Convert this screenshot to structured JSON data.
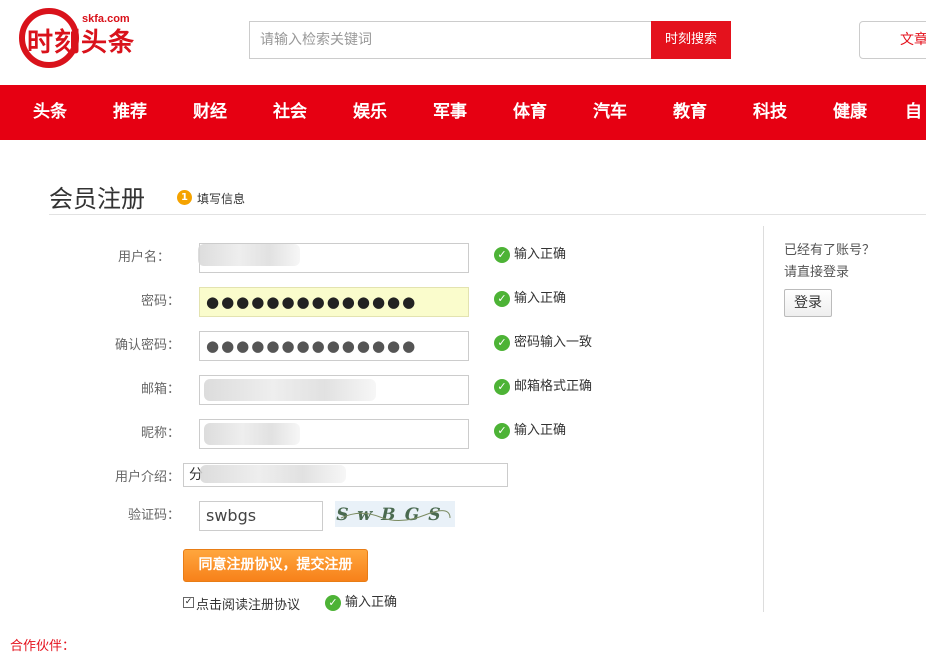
{
  "header": {
    "logo_text": "时刻头条",
    "logo_domain": "skfa.com",
    "search_placeholder": "请输入检索关键词",
    "search_button": "时刻搜索",
    "article_button": "文章"
  },
  "nav": {
    "items": [
      "头条",
      "推荐",
      "财经",
      "社会",
      "娱乐",
      "军事",
      "体育",
      "汽车",
      "教育",
      "科技",
      "健康",
      "自媒"
    ]
  },
  "page": {
    "title": "会员注册",
    "step_number": "1",
    "step_label": "填写信息"
  },
  "form": {
    "username_label": "用户名：",
    "password_label": "密码：",
    "password_mask": "●●●●●●●●●●●●●●",
    "confirm_label": "确认密码：",
    "confirm_mask": "●●●●●●●●●●●●●●",
    "email_label": "邮箱：",
    "nickname_label": "昵称：",
    "intro_label": "用户介绍：",
    "intro_value_start": "分",
    "captcha_label": "验证码：",
    "captcha_value": "swbgs",
    "captcha_image_text": "SwBGS",
    "submit_button": "同意注册协议，提交注册",
    "agree_label": "点击阅读注册协议",
    "status": {
      "username": "输入正确",
      "password": "输入正确",
      "confirm": "密码输入一致",
      "email": "邮箱格式正确",
      "nickname": "输入正确",
      "agree": "输入正确"
    }
  },
  "side": {
    "have_account": "已经有了账号？",
    "login_directly": "请直接登录",
    "login_button": "登录"
  },
  "footer": {
    "partners_label": "合作伙伴："
  }
}
